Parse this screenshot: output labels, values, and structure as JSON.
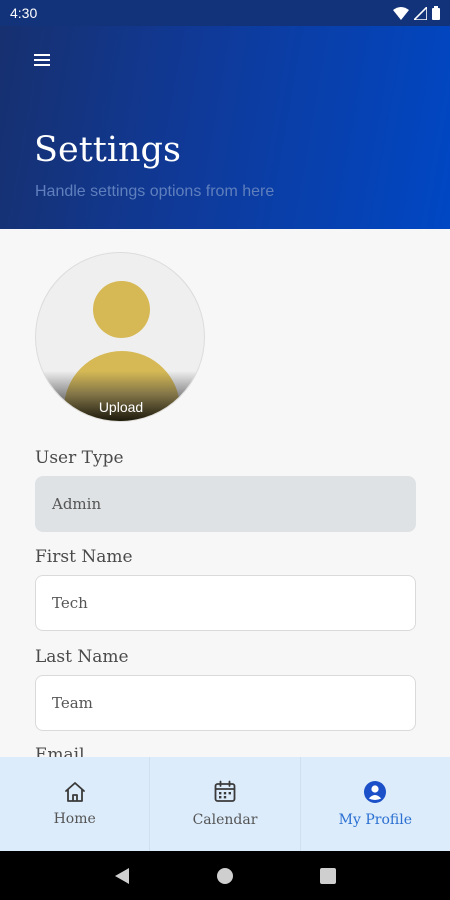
{
  "status_bar": {
    "time": "4:30"
  },
  "header": {
    "title": "Settings",
    "subtitle": "Handle settings options from here"
  },
  "avatar": {
    "upload_label": "Upload",
    "accent_color": "#d6b955"
  },
  "form": {
    "user_type": {
      "label": "User Type",
      "value": "Admin"
    },
    "first_name": {
      "label": "First Name",
      "value": "Tech"
    },
    "last_name": {
      "label": "Last Name",
      "value": "Team"
    },
    "email": {
      "label": "Email"
    }
  },
  "bottom_nav": {
    "items": [
      {
        "label": "Home",
        "icon": "home-icon"
      },
      {
        "label": "Calendar",
        "icon": "calendar-icon"
      },
      {
        "label": "My Profile",
        "icon": "profile-icon",
        "active": true
      }
    ],
    "active_color": "#2a6fd1"
  },
  "colors": {
    "header_start": "#17306f",
    "header_end": "#0047c4",
    "nav_background": "#dcecfb"
  }
}
